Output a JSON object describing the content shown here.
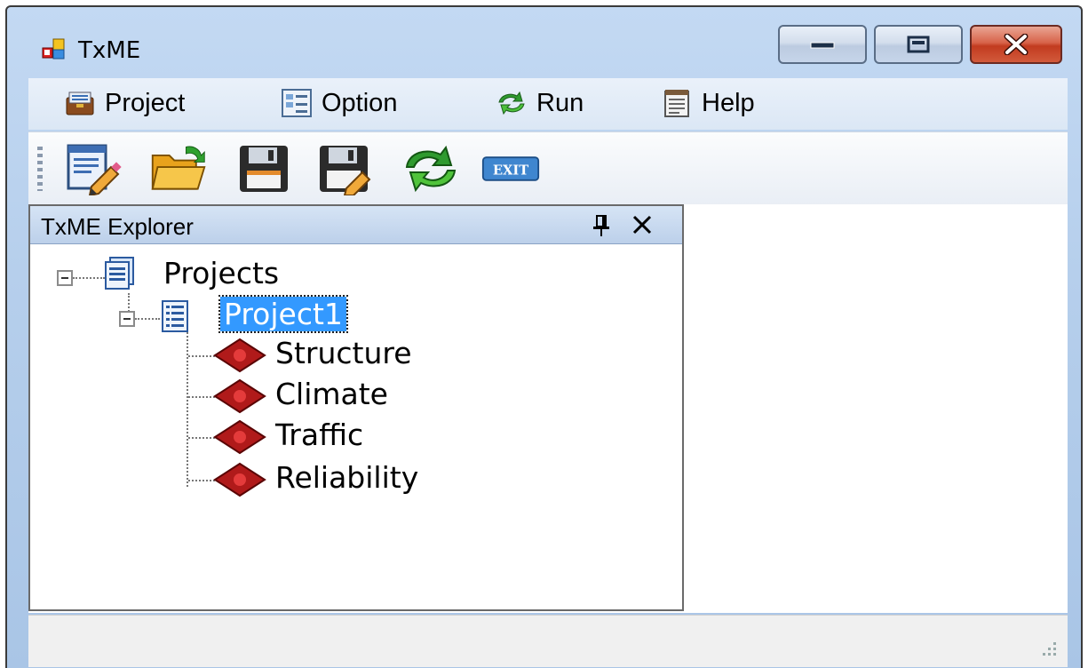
{
  "window": {
    "title": "TxME",
    "app_icon": "app-window-icon",
    "controls": {
      "minimize_icon": "minimize-icon",
      "maximize_icon": "maximize-icon",
      "close_icon": "close-icon"
    }
  },
  "menu": {
    "items": [
      {
        "label": "Project",
        "icon": "project-briefcase-icon"
      },
      {
        "label": "Option",
        "icon": "option-settings-icon"
      },
      {
        "label": "Run",
        "icon": "run-arrows-icon"
      },
      {
        "label": "Help",
        "icon": "help-book-icon"
      }
    ]
  },
  "toolbar": {
    "buttons": [
      {
        "icon": "new-project-icon"
      },
      {
        "icon": "open-folder-icon"
      },
      {
        "icon": "save-icon"
      },
      {
        "icon": "save-as-icon"
      },
      {
        "icon": "run-refresh-icon"
      },
      {
        "icon": "exit-icon",
        "label": "EXIT"
      }
    ]
  },
  "explorer": {
    "title": "TxME Explorer",
    "pin_glyph": "$",
    "close_glyph": "✕",
    "tree": {
      "root": "Projects",
      "project": "Project1",
      "children": [
        "Structure",
        "Climate",
        "Traffic",
        "Reliability"
      ]
    }
  },
  "colors": {
    "selection": "#3399ff",
    "title_gradient": "#b6cfec",
    "close_button": "#c23b1f",
    "node_diamond": "#b01a1a"
  }
}
